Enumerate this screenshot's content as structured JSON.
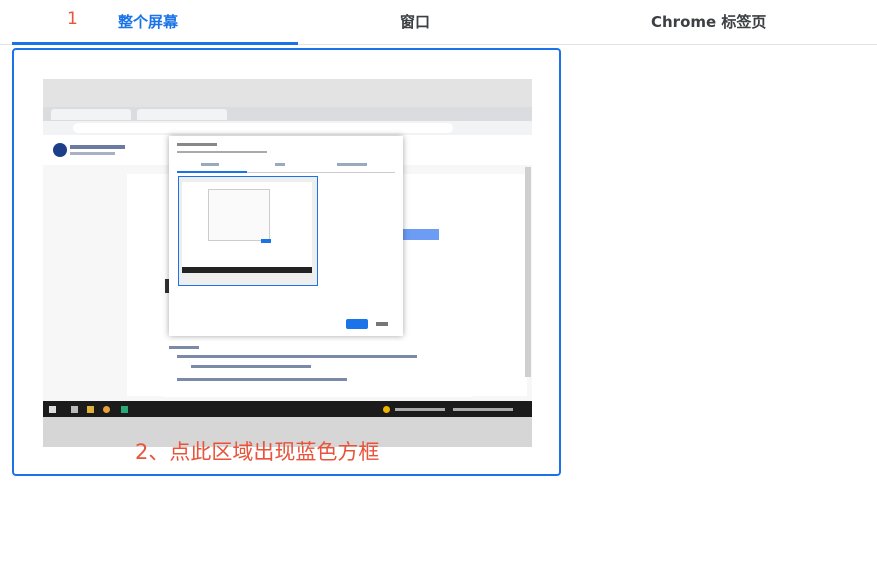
{
  "step_markers": {
    "step1": "1",
    "step2": "2、点此区域出现蓝色方框"
  },
  "tabs": [
    {
      "label": "整个屏幕",
      "active": true
    },
    {
      "label": "窗口",
      "active": false
    },
    {
      "label": "Chrome 标签页",
      "active": false
    }
  ],
  "colors": {
    "accent": "#1a73e8",
    "annotation": "#e8533a",
    "tab_text": "#3c4043"
  }
}
